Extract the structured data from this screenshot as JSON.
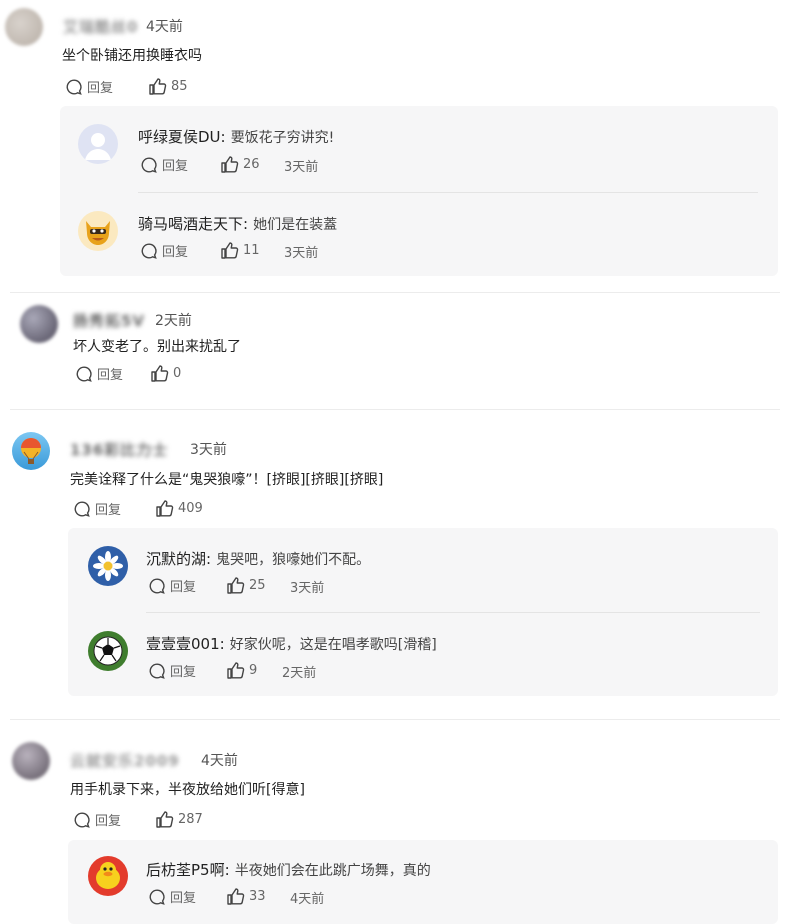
{
  "icons": {
    "reply": "comment-bubble-icon",
    "like": "thumbs-up-icon"
  },
  "reply_label": "回复",
  "comments": [
    {
      "username": "艾瑞酷丝0",
      "time": "4天前",
      "text": "坐个卧铺还用换睡衣吗",
      "likes": "85",
      "replies": [
        {
          "name": "呼绿夏侯DU:",
          "text": "要饭花子穷讲究!",
          "likes": "26",
          "time": "3天前"
        },
        {
          "name": "骑马喝酒走天下:",
          "text": "她们是在装蓋",
          "likes": "11",
          "time": "3天前"
        }
      ]
    },
    {
      "username": "扬秀拓5V",
      "time": "2天前",
      "text": "坏人变老了。别出来扰乱了",
      "likes": "0",
      "replies": []
    },
    {
      "username": "136彩比力士",
      "time": "3天前",
      "text": "完美诠释了什么是“鬼哭狼嚎”！[挤眼][挤眼][挤眼]",
      "likes": "409",
      "replies": [
        {
          "name": "沉默的湖:",
          "text": "鬼哭吧，狼嚎她们不配。",
          "likes": "25",
          "time": "3天前"
        },
        {
          "name": "壹壹壹001:",
          "text": "好家伙呢，这是在唱孝歌吗[滑稽]",
          "likes": "9",
          "time": "2天前"
        }
      ]
    },
    {
      "username": "云就安乐2009",
      "time": "4天前",
      "text": "用手机录下来，半夜放给她们听[得意]",
      "likes": "287",
      "replies": [
        {
          "name": "后枋荃P5啊:",
          "text": "半夜她们会在此跳广场舞，真的",
          "likes": "33",
          "time": "4天前"
        }
      ]
    }
  ]
}
